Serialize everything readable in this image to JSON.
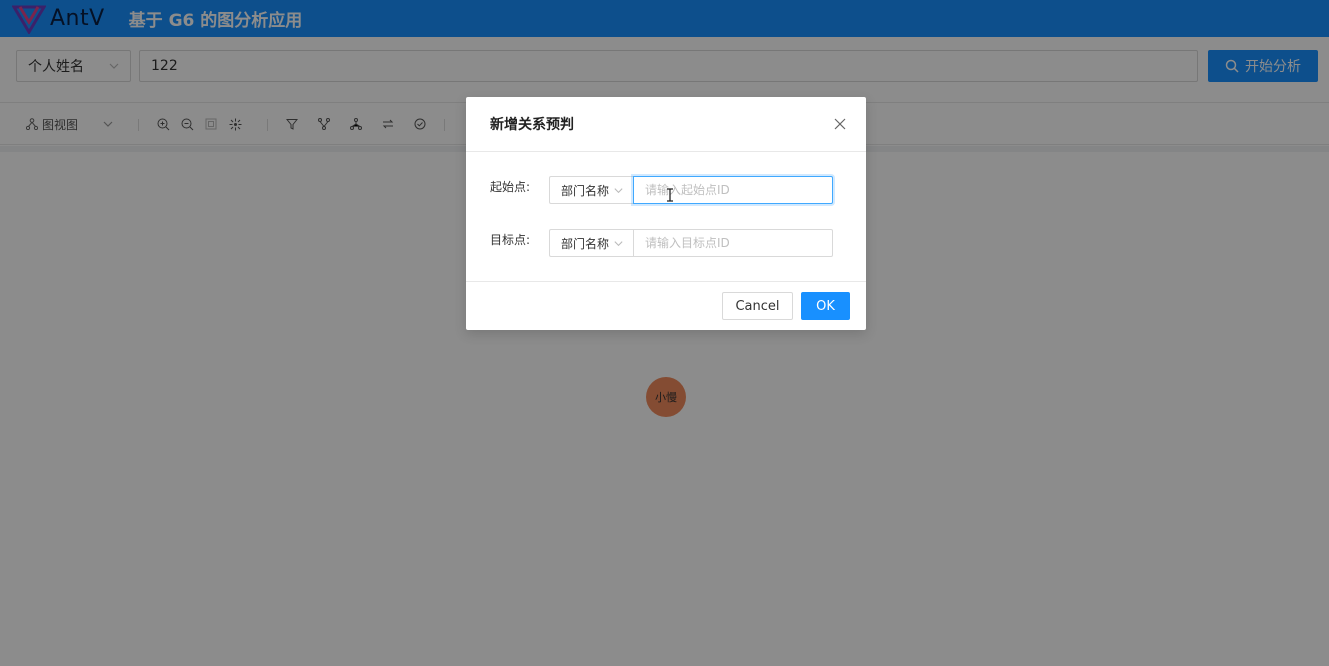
{
  "header": {
    "logo_text": "AntV",
    "title": "基于 G6 的图分析应用",
    "brand_color": "#1890ff"
  },
  "search": {
    "type_selected": "个人姓名",
    "query_value": "122",
    "analyze_label": "开始分析"
  },
  "toolbar": {
    "view_label": "图视图",
    "icons": [
      "layout-tree-icon",
      "zoom-in-icon",
      "zoom-out-icon",
      "fit-view-icon",
      "auto-layout-icon",
      "filter-icon",
      "branch-icon",
      "hierarchy-icon",
      "swap-icon",
      "check-circle-icon"
    ]
  },
  "canvas": {
    "node_label": "小慢",
    "node_color": "#f08a5d"
  },
  "modal": {
    "title": "新增关系预判",
    "start_label": "起始点:",
    "start_type": "部门名称",
    "start_placeholder": "请输入起始点ID",
    "target_label": "目标点:",
    "target_type": "部门名称",
    "target_placeholder": "请输入目标点ID",
    "cancel_label": "Cancel",
    "ok_label": "OK"
  }
}
